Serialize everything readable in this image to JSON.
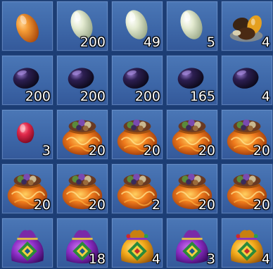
{
  "inventory": {
    "slots": [
      {
        "item": "amber-bean-icon",
        "qty": ""
      },
      {
        "item": "pale-jade-bean-icon",
        "qty": "200"
      },
      {
        "item": "pale-jade-bean-icon",
        "qty": "49"
      },
      {
        "item": "pale-jade-bean-icon",
        "qty": "5"
      },
      {
        "item": "mixed-beans-pile-icon",
        "qty": "4"
      },
      {
        "item": "dark-purple-bean-icon",
        "qty": "200"
      },
      {
        "item": "dark-purple-bean-icon",
        "qty": "200"
      },
      {
        "item": "dark-purple-bean-icon",
        "qty": "200"
      },
      {
        "item": "dark-purple-bean-icon",
        "qty": "165"
      },
      {
        "item": "dark-purple-bean-icon",
        "qty": "4"
      },
      {
        "item": "red-bean-icon",
        "qty": "3"
      },
      {
        "item": "fiery-bean-pouch-icon",
        "qty": "20"
      },
      {
        "item": "fiery-bean-pouch-icon",
        "qty": "20"
      },
      {
        "item": "fiery-bean-pouch-icon",
        "qty": "20"
      },
      {
        "item": "fiery-bean-pouch-icon",
        "qty": "20"
      },
      {
        "item": "fiery-bean-pouch-icon",
        "qty": "20"
      },
      {
        "item": "fiery-bean-pouch-icon",
        "qty": "20"
      },
      {
        "item": "fiery-bean-pouch-icon",
        "qty": "2"
      },
      {
        "item": "fiery-bean-pouch-icon",
        "qty": "20"
      },
      {
        "item": "fiery-bean-pouch-icon",
        "qty": "20"
      },
      {
        "item": "purple-lucky-bag-icon",
        "qty": ""
      },
      {
        "item": "purple-lucky-bag-icon",
        "qty": "18"
      },
      {
        "item": "gold-lucky-bag-icon",
        "qty": "4"
      },
      {
        "item": "purple-lucky-bag-icon",
        "qty": "3"
      },
      {
        "item": "gold-lucky-bag-icon",
        "qty": "4"
      }
    ]
  },
  "colors": {
    "slot_bg": "#4470b0",
    "slot_border": "#27487f",
    "page_bg": "#1c3d74",
    "qty_text": "#ffffff"
  }
}
